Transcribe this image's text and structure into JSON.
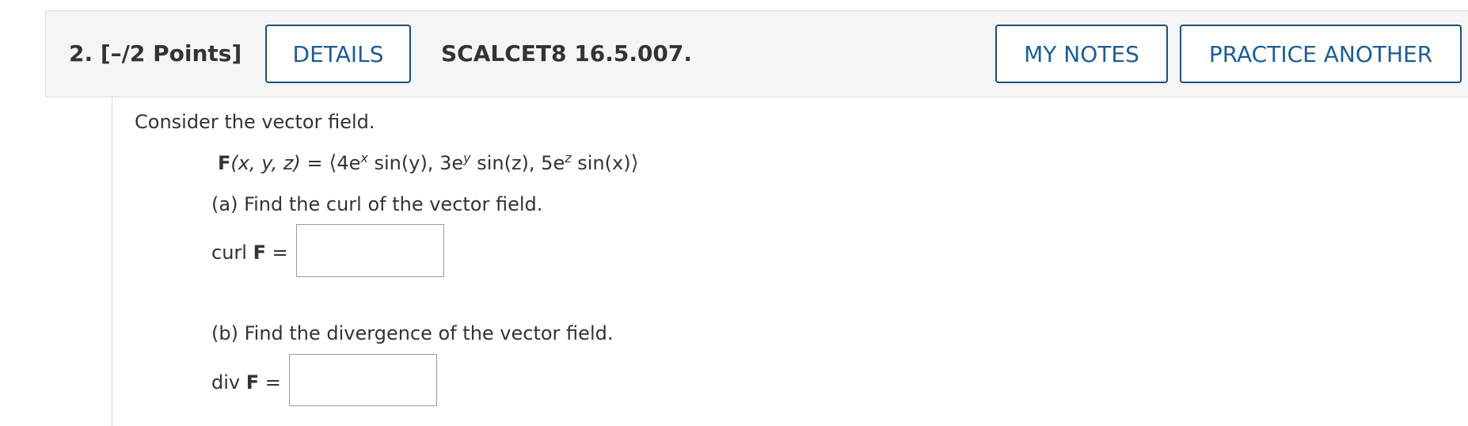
{
  "header": {
    "question_number": "2.",
    "points": "[–/2 Points]",
    "details_label": "DETAILS",
    "problem_code": "SCALCET8 16.5.007.",
    "my_notes_label": "MY NOTES",
    "practice_another_label": "PRACTICE ANOTHER"
  },
  "problem": {
    "intro": "Consider the vector field.",
    "formula": {
      "lhs_func": "F",
      "lhs_args": "(x, y, z)",
      "equals": "=",
      "open": "⟨",
      "c1_coef": "4e",
      "c1_exp": "x",
      "c1_rest": " sin(y),",
      "c2_coef": " 3e",
      "c2_exp": "y",
      "c2_rest": " sin(z),",
      "c3_coef": " 5e",
      "c3_exp": "z",
      "c3_rest": " sin(x)",
      "close": "⟩"
    },
    "part_a": "(a) Find the curl of the vector field.",
    "curl_label": "curl",
    "curl_var": "F",
    "curl_eq": "=",
    "part_b": "(b) Find the divergence of the vector field.",
    "div_label": "div",
    "div_var": "F",
    "div_eq": "="
  },
  "answers": {
    "curl_value": "",
    "div_value": ""
  },
  "colors": {
    "button_border": "#1d4f7a",
    "button_text": "#1d5d96",
    "header_bg": "#f5f5f5",
    "text": "#333333"
  }
}
